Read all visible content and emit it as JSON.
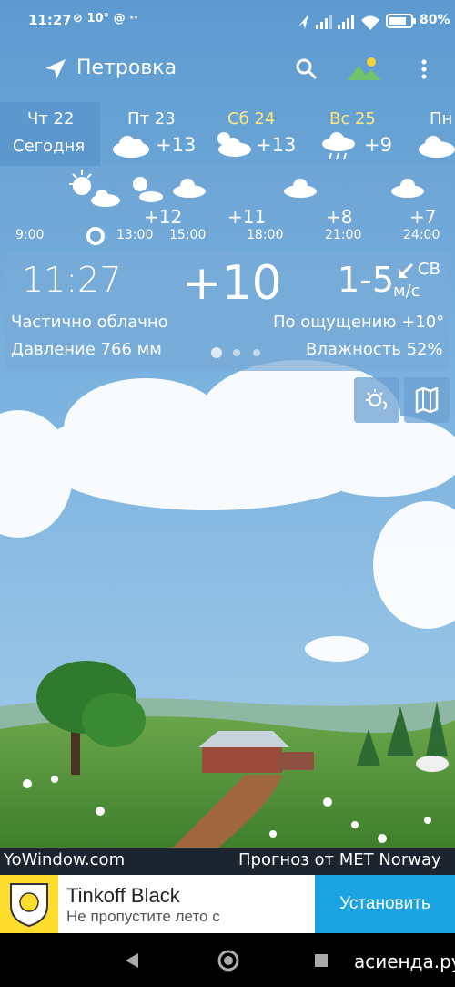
{
  "status_bar": {
    "time": "11:27",
    "notif_temp": "10°",
    "battery_pct": "80%"
  },
  "toolbar": {
    "location": "Петровка",
    "icons": [
      "location-arrow-icon",
      "search-icon",
      "landscape-icon",
      "more-vert-icon"
    ]
  },
  "days": [
    {
      "name": "Чт 22",
      "sub": "Сегодня",
      "selected": true,
      "color": "#ffffff"
    },
    {
      "name": "Пт 23",
      "temp": "+13",
      "icon": "cloud-icon",
      "color": "#ffffff"
    },
    {
      "name": "Сб 24",
      "temp": "+13",
      "icon": "partly-cloudy-icon",
      "color": "#ffe680"
    },
    {
      "name": "Вс 25",
      "temp": "+9",
      "icon": "rain-cloud-icon",
      "color": "#ffe680"
    },
    {
      "name": "Пн",
      "icon": "cloud-icon",
      "color": "#ffffff"
    }
  ],
  "hourly": {
    "times": [
      "9:00",
      "13:00",
      "15:00",
      "18:00",
      "21:00",
      "24:00"
    ],
    "temps": [
      "+12",
      "+11",
      "+8",
      "+7"
    ]
  },
  "current": {
    "time": "11:27",
    "temp": "+10",
    "wind_speed": "1-5",
    "wind_dir": "СВ",
    "wind_unit": "м/с",
    "condition": "Частично облачно",
    "feels_like": "По ощущению +10°",
    "pressure": "Давление 766 мм",
    "humidity": "Влажность 52%",
    "page_dots": 3,
    "active_dot": 0
  },
  "scene_buttons": [
    "weather-settings-icon",
    "map-icon"
  ],
  "footer": {
    "brand": "YoWindow.com",
    "provider": "Прогноз от MET Norway"
  },
  "ad": {
    "title": "Tinkoff Black",
    "subtitle": "Не пропустите лето с",
    "button": "Установить",
    "button_color": "#1aa3e0",
    "logo_color": "#ffdd2d"
  },
  "watermark": "асиенда.ру"
}
